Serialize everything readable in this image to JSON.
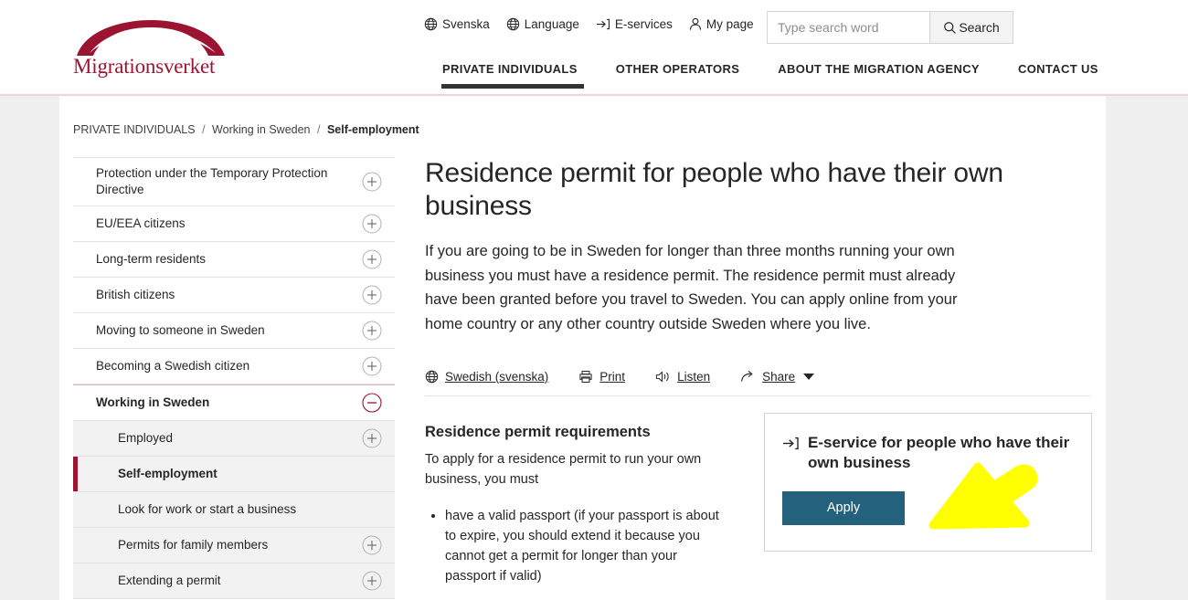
{
  "header": {
    "logo_text": "Migrationsverket",
    "logo_icon": "arch-logo-icon",
    "brand_color": "#9b1432",
    "utility_nav": [
      {
        "label": "Svenska",
        "icon": "globe-icon"
      },
      {
        "label": "Language",
        "icon": "globe-icon"
      },
      {
        "label": "E-services",
        "icon": "arrow-into-bracket-icon"
      },
      {
        "label": "My page",
        "icon": "person-icon"
      }
    ],
    "search": {
      "placeholder": "Type search word",
      "value": "",
      "button_label": "Search",
      "button_icon": "search-icon"
    },
    "main_nav": [
      {
        "label": "PRIVATE INDIVIDUALS",
        "active": true
      },
      {
        "label": "OTHER OPERATORS",
        "active": false
      },
      {
        "label": "ABOUT THE MIGRATION AGENCY",
        "active": false
      },
      {
        "label": "CONTACT US",
        "active": false
      }
    ]
  },
  "breadcrumb": {
    "items": [
      "PRIVATE INDIVIDUALS",
      "Working in Sweden"
    ],
    "current": "Self-employment",
    "separator": "/"
  },
  "sidebar": {
    "items": [
      {
        "label": "Protection under the Temporary Protection Directive",
        "icon": "plus-circle-icon",
        "state": "collapsed",
        "level": 0,
        "two_line": true
      },
      {
        "label": "EU/EEA citizens",
        "icon": "plus-circle-icon",
        "state": "collapsed",
        "level": 0
      },
      {
        "label": "Long-term residents",
        "icon": "plus-circle-icon",
        "state": "collapsed",
        "level": 0
      },
      {
        "label": "British citizens",
        "icon": "plus-circle-icon",
        "state": "collapsed",
        "level": 0
      },
      {
        "label": "Moving to someone in Sweden",
        "icon": "plus-circle-icon",
        "state": "collapsed",
        "level": 0
      },
      {
        "label": "Becoming a Swedish citizen",
        "icon": "plus-circle-icon",
        "state": "collapsed",
        "level": 0
      },
      {
        "label": "Working in Sweden",
        "icon": "minus-circle-icon",
        "state": "expanded",
        "level": 0
      },
      {
        "label": "Employed",
        "icon": "plus-circle-icon",
        "state": "collapsed",
        "level": 1
      },
      {
        "label": "Self-employment",
        "icon": "none",
        "state": "current",
        "level": 1
      },
      {
        "label": "Look for work or start a business",
        "icon": "none",
        "state": "normal",
        "level": 1
      },
      {
        "label": "Permits for family members",
        "icon": "plus-circle-icon",
        "state": "collapsed",
        "level": 1
      },
      {
        "label": "Extending a permit",
        "icon": "plus-circle-icon",
        "state": "collapsed",
        "level": 1
      }
    ]
  },
  "main": {
    "title": "Residence permit for people who have their own business",
    "intro": "If you are going to be in Sweden for longer than three months running your own business you must have a residence permit. The residence permit must already have been granted before you travel to Sweden. You can apply online from your home country or any other country outside Sweden where you live.",
    "tools": [
      {
        "label": "Swedish (svenska)",
        "icon": "globe-icon"
      },
      {
        "label": "Print",
        "icon": "printer-icon"
      },
      {
        "label": "Listen",
        "icon": "speaker-icon"
      },
      {
        "label": "Share",
        "icon": "share-icon",
        "has_caret": true
      }
    ],
    "requirements": {
      "heading": "Residence permit requirements",
      "intro": "To apply for a residence permit to run your own business, you must",
      "bullets": [
        "have a valid passport (if your passport is about to expire, you should extend it because you cannot get a permit for longer than your passport if valid)"
      ]
    },
    "eservice": {
      "title": "E-service for people who have their own business",
      "icon": "arrow-into-bracket-icon",
      "button_label": "Apply",
      "button_color": "#24617c"
    }
  },
  "annotation": {
    "type": "arrow-pointer",
    "color": "#ffff00",
    "points_to": "apply-button"
  }
}
